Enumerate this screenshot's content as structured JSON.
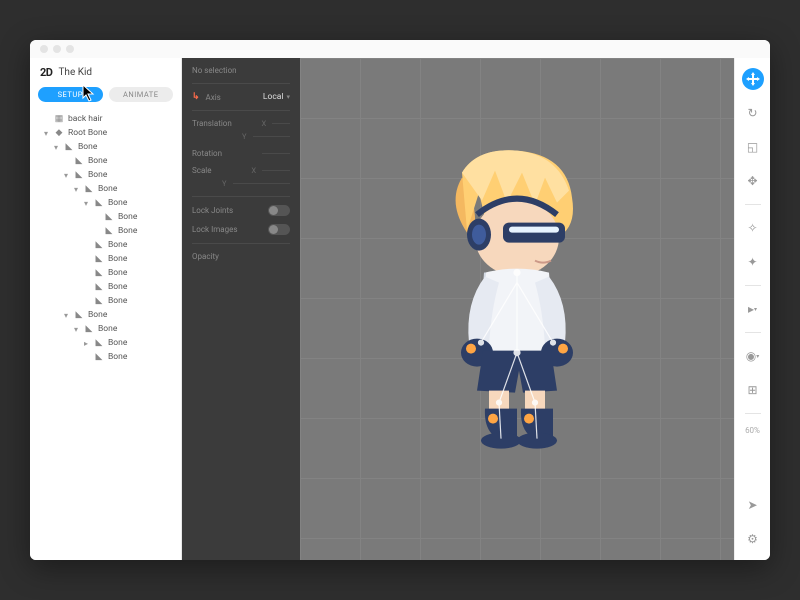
{
  "project_name": "The Kid",
  "logo_text": "2D",
  "tabs": {
    "setup": "SETUP",
    "animate": "ANIMATE"
  },
  "tree": [
    {
      "depth": 0,
      "icon": "image",
      "label": "back hair",
      "caret": ""
    },
    {
      "depth": 0,
      "icon": "diamond",
      "label": "Root Bone",
      "caret": "▾"
    },
    {
      "depth": 1,
      "icon": "bone",
      "label": "Bone",
      "caret": "▾"
    },
    {
      "depth": 2,
      "icon": "bone",
      "label": "Bone",
      "caret": ""
    },
    {
      "depth": 2,
      "icon": "bone",
      "label": "Bone",
      "caret": "▾"
    },
    {
      "depth": 3,
      "icon": "bone",
      "label": "Bone",
      "caret": "▾"
    },
    {
      "depth": 4,
      "icon": "bone",
      "label": "Bone",
      "caret": "▾"
    },
    {
      "depth": 5,
      "icon": "bone",
      "label": "Bone",
      "caret": ""
    },
    {
      "depth": 5,
      "icon": "bone",
      "label": "Bone",
      "caret": ""
    },
    {
      "depth": 4,
      "icon": "bone",
      "label": "Bone",
      "caret": ""
    },
    {
      "depth": 4,
      "icon": "bone",
      "label": "Bone",
      "caret": ""
    },
    {
      "depth": 4,
      "icon": "bone",
      "label": "Bone",
      "caret": ""
    },
    {
      "depth": 4,
      "icon": "bone",
      "label": "Bone",
      "caret": ""
    },
    {
      "depth": 4,
      "icon": "bone",
      "label": "Bone",
      "caret": ""
    },
    {
      "depth": 2,
      "icon": "bone",
      "label": "Bone",
      "caret": "▾"
    },
    {
      "depth": 3,
      "icon": "bone",
      "label": "Bone",
      "caret": "▾"
    },
    {
      "depth": 4,
      "icon": "bone",
      "label": "Bone",
      "caret": "▸"
    },
    {
      "depth": 4,
      "icon": "bone",
      "label": "Bone",
      "caret": ""
    }
  ],
  "props": {
    "header": "No selection",
    "axis_label": "Axis",
    "axis_value": "Local",
    "translation": "Translation",
    "rotation": "Rotation",
    "scale": "Scale",
    "x": "X",
    "y": "Y",
    "lock_joints": "Lock Joints",
    "lock_images": "Lock Images",
    "opacity": "Opacity"
  },
  "toolbar": {
    "zoom": "60%"
  }
}
